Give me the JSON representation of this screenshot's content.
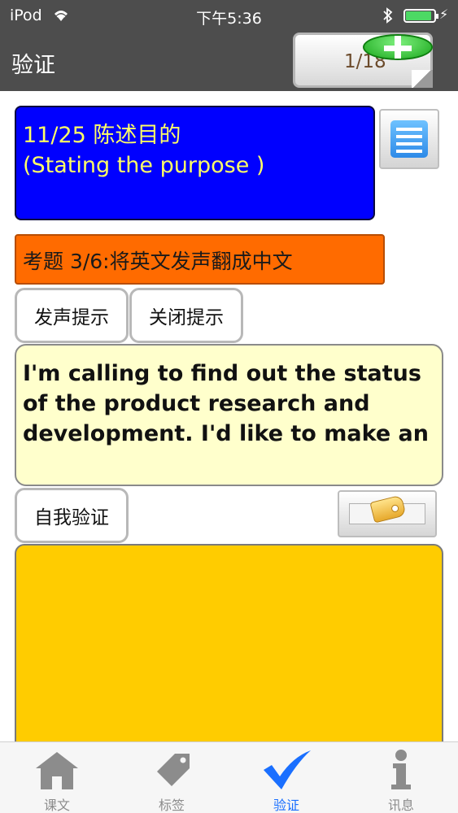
{
  "status_bar": {
    "carrier": "iPod",
    "time": "下午5:36",
    "battery_level": 0.9
  },
  "nav": {
    "title": "验证",
    "counter": "1/18"
  },
  "lesson": {
    "line1": "11/25 陈述目的",
    "line2": "(Stating the purpose )"
  },
  "question": {
    "label": "考题 3/6:将英文发声翻成中文"
  },
  "buttons": {
    "voice_hint": "发声提示",
    "close_hint": "关闭提示",
    "self_check": "自我验证"
  },
  "prompt_text": "I'm calling to find out the status of the product research and development. I'd like to make an",
  "tabs": [
    {
      "label": "课文",
      "icon": "house-icon",
      "active": false
    },
    {
      "label": "标签",
      "icon": "tag-icon",
      "active": false
    },
    {
      "label": "验证",
      "icon": "checkmark-icon",
      "active": true
    },
    {
      "label": "讯息",
      "icon": "info-icon",
      "active": false
    }
  ],
  "colors": {
    "nav_bg": "#4d4d4d",
    "lesson_bg": "#0000ff",
    "lesson_text": "#ffff66",
    "question_bg": "#ff6b00",
    "prompt_bg": "#ffffcc",
    "answer_bg": "#ffcc00",
    "tab_active": "#1a6fff",
    "tab_inactive": "#8c8c8c"
  }
}
